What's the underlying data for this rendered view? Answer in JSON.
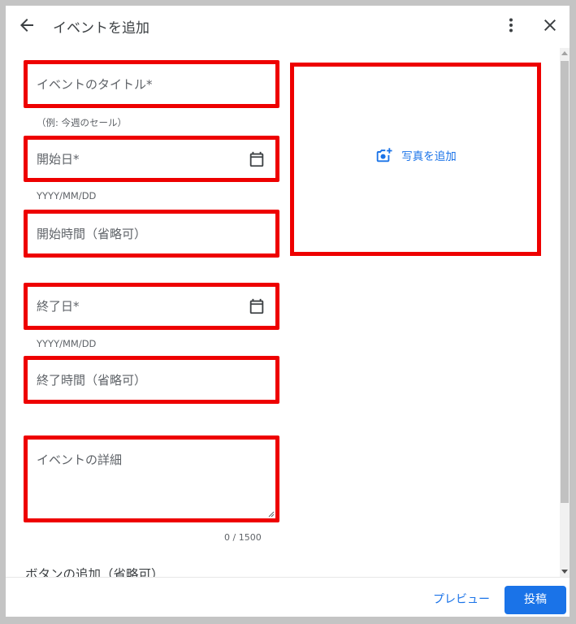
{
  "header": {
    "title": "イベントを追加"
  },
  "form": {
    "title_field": {
      "placeholder": "イベントのタイトル*",
      "value": "",
      "helper": "（例: 今週のセール）"
    },
    "start_date": {
      "placeholder": "開始日*",
      "value": "",
      "helper": "YYYY/MM/DD",
      "icon": "calendar-icon"
    },
    "start_time": {
      "placeholder": "開始時間（省略可）",
      "value": ""
    },
    "end_date": {
      "placeholder": "終了日*",
      "value": "",
      "helper": "YYYY/MM/DD",
      "icon": "calendar-icon"
    },
    "end_time": {
      "placeholder": "終了時間（省略可）",
      "value": ""
    },
    "details": {
      "placeholder": "イベントの詳細",
      "value": "",
      "counter": "0 / 1500"
    },
    "button_section_title": "ボタンの追加（省略可）"
  },
  "photo": {
    "label": "写真を追加",
    "icon": "add-photo-icon"
  },
  "footer": {
    "preview_label": "プレビュー",
    "post_label": "投稿"
  },
  "colors": {
    "accent": "#1a73e8",
    "highlight_border": "#ee0000"
  }
}
